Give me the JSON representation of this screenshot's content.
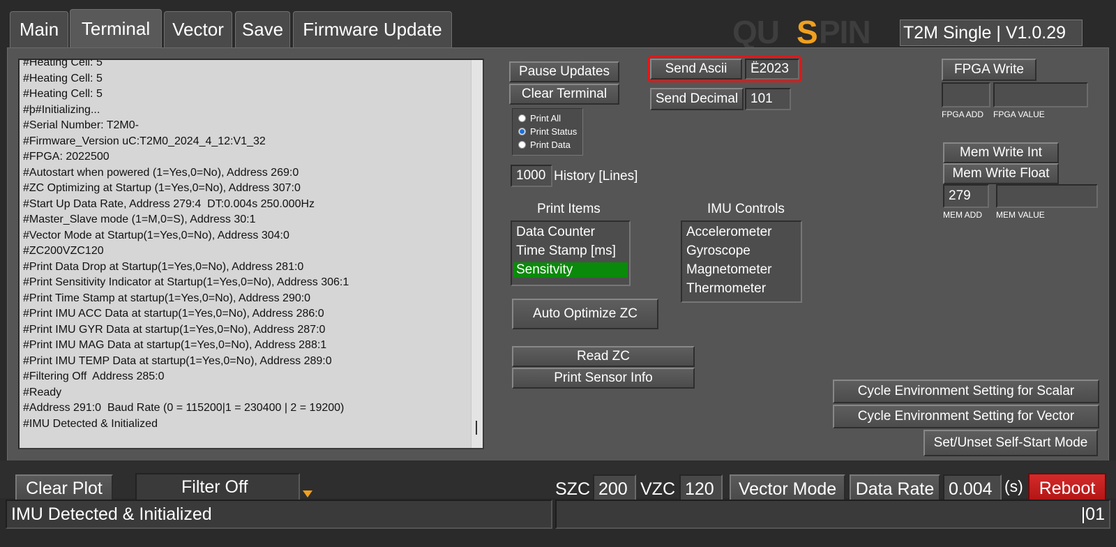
{
  "tabs": [
    "Main",
    "Terminal",
    "Vector",
    "Save",
    "Firmware Update"
  ],
  "brand": {
    "logo_text": "QUSPIN",
    "version": "T2M Single | V1.0.29"
  },
  "terminal": {
    "lines": [
      "#Heating Cell: 5",
      "#Heating Cell: 5",
      "#Heating Cell: 5",
      "#þ#Initializing...",
      "#Serial Number: T2M0-",
      "#Firmware_Version uC:T2M0_2024_4_12:V1_32",
      "#FPGA: 2022500",
      "#Autostart when powered (1=Yes,0=No), Address 269:0",
      "#ZC Optimizing at Startup (1=Yes,0=No), Address 307:0",
      "#Start Up Data Rate, Address 279:4  DT:0.004s 250.000Hz",
      "#Master_Slave mode (1=M,0=S), Address 30:1",
      "#Vector Mode at Startup(1=Yes,0=No), Address 304:0",
      "#ZC200VZC120",
      "#Print Data Drop at Startup(1=Yes,0=No), Address 281:0",
      "#Print Sensitivity Indicator at Startup(1=Yes,0=No), Address 306:1",
      "#Print Time Stamp at startup(1=Yes,0=No), Address 290:0",
      "#Print IMU ACC Data at startup(1=Yes,0=No), Address 286:0",
      "#Print IMU GYR Data at startup(1=Yes,0=No), Address 287:0",
      "#Print IMU MAG Data at startup(1=Yes,0=No), Address 288:1",
      "#Print IMU TEMP Data at startup(1=Yes,0=No), Address 289:0",
      "#Filtering Off  Address 285:0",
      "#Ready",
      "#Address 291:0  Baud Rate (0 = 115200|1 = 230400 | 2 = 19200)",
      "#IMU Detected & Initialized"
    ]
  },
  "controls": {
    "pause_updates": "Pause Updates",
    "clear_terminal": "Clear Terminal",
    "send_ascii": "Send Ascii",
    "send_ascii_value": "Ë2023",
    "send_decimal": "Send Decimal",
    "send_decimal_value": "101",
    "print_mode": {
      "options": [
        "Print All",
        "Print Status",
        "Print Data"
      ],
      "selected": "Print Status"
    },
    "history_value": "1000",
    "history_label": "History [Lines]",
    "print_items_title": "Print Items",
    "print_items": [
      "Data Counter",
      "Time Stamp [ms]",
      "Sensitvity"
    ],
    "print_items_selected": "Sensitvity",
    "imu_controls_title": "IMU Controls",
    "imu_controls": [
      "Accelerometer",
      "Gyroscope",
      "Magnetometer",
      "Thermometer"
    ],
    "auto_optimize": "Auto Optimize ZC",
    "read_zc": "Read ZC",
    "print_sensor_info": "Print Sensor Info"
  },
  "fpga": {
    "write": "FPGA Write",
    "add_label": "FPGA ADD",
    "value_label": "FPGA VALUE",
    "add_value": "",
    "value_value": ""
  },
  "mem": {
    "write_int": "Mem Write Int",
    "write_float": "Mem Write Float",
    "add_value": "279",
    "value_value": "",
    "add_label": "MEM ADD",
    "value_label": "MEM VALUE"
  },
  "env": {
    "scalar": "Cycle Environment Setting for Scalar",
    "vector": "Cycle Environment Setting for Vector",
    "self_start": "Set/Unset Self-Start Mode"
  },
  "bottom": {
    "clear_plot": "Clear Plot",
    "filter": "Filter Off",
    "szc_label": "SZC",
    "szc_value": "200",
    "vzc_label": "VZC",
    "vzc_value": "120",
    "vector_mode": "Vector Mode",
    "data_rate": "Data Rate",
    "data_rate_value": "0.004",
    "unit": "(s)",
    "reboot": "Reboot"
  },
  "status": {
    "message": "IMU Detected & Initialized",
    "right": "|01"
  },
  "colors": {
    "highlight_ring": "#e01818",
    "selected_item": "#0a8a0a",
    "reboot": "#c41a1a",
    "logo_accent": "#f0a020"
  }
}
